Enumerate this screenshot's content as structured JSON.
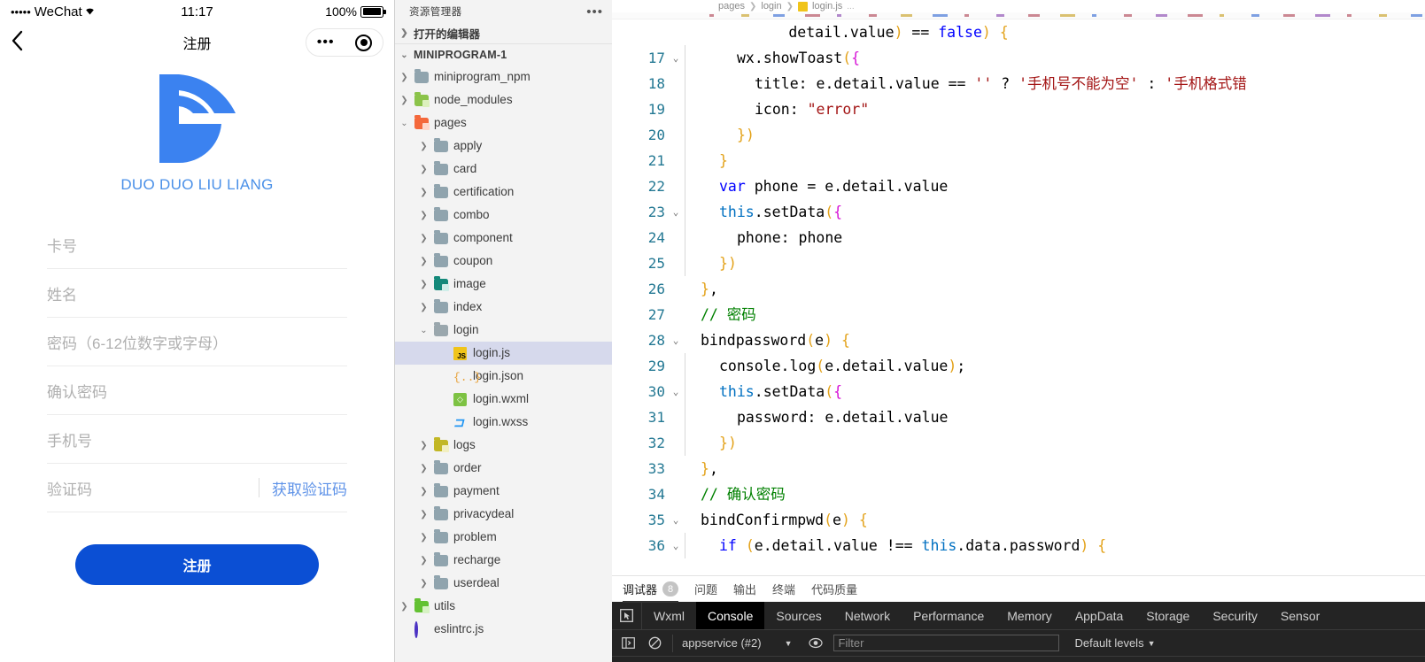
{
  "simulator": {
    "status_bar": {
      "signal_dots": "•••••",
      "carrier": "WeChat",
      "wifi_icon": "wifi-icon",
      "time": "11:17",
      "battery_percent": "100%",
      "battery_icon": "battery-full-icon"
    },
    "nav_bar": {
      "back_icon": "back-chevron-icon",
      "title": "注册",
      "capsule_menu_icon": "more-dots-icon",
      "capsule_close_icon": "target-circle-icon"
    },
    "brand": {
      "logo_icon": "duoduoliuliang-logo-icon",
      "logo_color": "#3b82f0",
      "name": "DUO DUO LIU LIANG"
    },
    "form": {
      "fields": [
        {
          "name": "card-number",
          "placeholder": "卡号"
        },
        {
          "name": "full-name",
          "placeholder": "姓名"
        },
        {
          "name": "password",
          "placeholder": "密码（6-12位数字或字母）"
        },
        {
          "name": "confirm-password",
          "placeholder": "确认密码"
        },
        {
          "name": "phone",
          "placeholder": "手机号"
        },
        {
          "name": "verify-code",
          "placeholder": "验证码"
        }
      ],
      "get_code_label": "获取验证码",
      "get_code_color": "#5f93e8",
      "submit_label": "注册",
      "submit_color": "#0b4fd4"
    }
  },
  "explorer": {
    "header_title": "资源管理器",
    "header_more_icon": "ellipsis-icon",
    "open_editors_label": "打开的编辑器",
    "root_label": "MINIPROGRAM-1",
    "tree": [
      {
        "label": "miniprogram_npm",
        "type": "folder",
        "depth": 1,
        "expanded": false,
        "icon": "folder-gray-icon"
      },
      {
        "label": "node_modules",
        "type": "folder",
        "depth": 1,
        "expanded": false,
        "icon": "folder-node-icon"
      },
      {
        "label": "pages",
        "type": "folder",
        "depth": 1,
        "expanded": true,
        "icon": "folder-pages-icon"
      },
      {
        "label": "apply",
        "type": "folder",
        "depth": 2,
        "expanded": false,
        "icon": "folder-gray-icon"
      },
      {
        "label": "card",
        "type": "folder",
        "depth": 2,
        "expanded": false,
        "icon": "folder-gray-icon"
      },
      {
        "label": "certification",
        "type": "folder",
        "depth": 2,
        "expanded": false,
        "icon": "folder-gray-icon"
      },
      {
        "label": "combo",
        "type": "folder",
        "depth": 2,
        "expanded": false,
        "icon": "folder-gray-icon"
      },
      {
        "label": "component",
        "type": "folder",
        "depth": 2,
        "expanded": false,
        "icon": "folder-gray-icon"
      },
      {
        "label": "coupon",
        "type": "folder",
        "depth": 2,
        "expanded": false,
        "icon": "folder-gray-icon"
      },
      {
        "label": "image",
        "type": "folder",
        "depth": 2,
        "expanded": false,
        "icon": "folder-image-icon"
      },
      {
        "label": "index",
        "type": "folder",
        "depth": 2,
        "expanded": false,
        "icon": "folder-gray-icon"
      },
      {
        "label": "login",
        "type": "folder",
        "depth": 2,
        "expanded": true,
        "icon": "folder-open-icon"
      },
      {
        "label": "login.js",
        "type": "file",
        "depth": 3,
        "icon": "js-file-icon",
        "selected": true
      },
      {
        "label": "login.json",
        "type": "file",
        "depth": 3,
        "icon": "json-file-icon",
        "selected": false
      },
      {
        "label": "login.wxml",
        "type": "file",
        "depth": 3,
        "icon": "wxml-file-icon",
        "selected": false
      },
      {
        "label": "login.wxss",
        "type": "file",
        "depth": 3,
        "icon": "wxss-file-icon",
        "selected": false
      },
      {
        "label": "logs",
        "type": "folder",
        "depth": 2,
        "expanded": false,
        "icon": "folder-logs-icon"
      },
      {
        "label": "order",
        "type": "folder",
        "depth": 2,
        "expanded": false,
        "icon": "folder-gray-icon"
      },
      {
        "label": "payment",
        "type": "folder",
        "depth": 2,
        "expanded": false,
        "icon": "folder-gray-icon"
      },
      {
        "label": "privacydeal",
        "type": "folder",
        "depth": 2,
        "expanded": false,
        "icon": "folder-gray-icon"
      },
      {
        "label": "problem",
        "type": "folder",
        "depth": 2,
        "expanded": false,
        "icon": "folder-gray-icon"
      },
      {
        "label": "recharge",
        "type": "folder",
        "depth": 2,
        "expanded": false,
        "icon": "folder-gray-icon"
      },
      {
        "label": "userdeal",
        "type": "folder",
        "depth": 2,
        "expanded": false,
        "icon": "folder-gray-icon"
      },
      {
        "label": "utils",
        "type": "folder",
        "depth": 1,
        "expanded": false,
        "icon": "folder-utils-icon"
      },
      {
        "label": "eslintrc.js",
        "type": "file",
        "depth": 1,
        "icon": "eslint-file-icon",
        "selected": false
      }
    ]
  },
  "editor": {
    "breadcrumb": {
      "pages": "pages",
      "login": "login",
      "file": "login.js",
      "more": "..."
    },
    "first_line_partial": "detail.value) == false) {",
    "lines": [
      {
        "num": "17",
        "fold": true,
        "indent": 2,
        "text": "wx.showToast({"
      },
      {
        "num": "18",
        "fold": false,
        "indent": 3,
        "text": "title: e.detail.value == '' ? '手机号不能为空' : '手机格式错"
      },
      {
        "num": "19",
        "fold": false,
        "indent": 3,
        "text": "icon: \"error\""
      },
      {
        "num": "20",
        "fold": false,
        "indent": 2,
        "text": "})"
      },
      {
        "num": "21",
        "fold": false,
        "indent": 1,
        "text": "}"
      },
      {
        "num": "22",
        "fold": false,
        "indent": 1,
        "text": "var phone = e.detail.value"
      },
      {
        "num": "23",
        "fold": true,
        "indent": 1,
        "text": "this.setData({"
      },
      {
        "num": "24",
        "fold": false,
        "indent": 2,
        "text": "phone: phone"
      },
      {
        "num": "25",
        "fold": false,
        "indent": 1,
        "text": "})"
      },
      {
        "num": "26",
        "fold": false,
        "indent": 0,
        "text": "},"
      },
      {
        "num": "27",
        "fold": false,
        "indent": 0,
        "text": "// 密码"
      },
      {
        "num": "28",
        "fold": true,
        "indent": 0,
        "text": "bindpassword(e) {"
      },
      {
        "num": "29",
        "fold": false,
        "indent": 1,
        "text": "console.log(e.detail.value);"
      },
      {
        "num": "30",
        "fold": true,
        "indent": 1,
        "text": "this.setData({"
      },
      {
        "num": "31",
        "fold": false,
        "indent": 2,
        "text": "password: e.detail.value"
      },
      {
        "num": "32",
        "fold": false,
        "indent": 1,
        "text": "})"
      },
      {
        "num": "33",
        "fold": false,
        "indent": 0,
        "text": "},"
      },
      {
        "num": "34",
        "fold": false,
        "indent": 0,
        "text": "// 确认密码"
      },
      {
        "num": "35",
        "fold": true,
        "indent": 0,
        "text": "bindConfirmpwd(e) {"
      },
      {
        "num": "36",
        "fold": true,
        "indent": 1,
        "text": "if (e.detail.value !== this.data.password) {"
      }
    ]
  },
  "panel": {
    "tabs": [
      {
        "label": "调试器",
        "badge": "8",
        "active": true
      },
      {
        "label": "问题",
        "badge": "",
        "active": false
      },
      {
        "label": "输出",
        "badge": "",
        "active": false
      },
      {
        "label": "终端",
        "badge": "",
        "active": false
      },
      {
        "label": "代码质量",
        "badge": "",
        "active": false
      }
    ]
  },
  "devtools": {
    "inspect_icon": "inspect-element-icon",
    "tabs": [
      {
        "label": "Wxml",
        "active": false
      },
      {
        "label": "Console",
        "active": true
      },
      {
        "label": "Sources",
        "active": false
      },
      {
        "label": "Network",
        "active": false
      },
      {
        "label": "Performance",
        "active": false
      },
      {
        "label": "Memory",
        "active": false
      },
      {
        "label": "AppData",
        "active": false
      },
      {
        "label": "Storage",
        "active": false
      },
      {
        "label": "Security",
        "active": false
      },
      {
        "label": "Sensor",
        "active": false
      }
    ],
    "toolbar": {
      "sidebar_icon": "console-sidebar-icon",
      "clear_icon": "clear-console-icon",
      "context_value": "appservice (#2)",
      "context_caret": "▼",
      "eye_icon": "live-expression-icon",
      "filter_placeholder": "Filter",
      "levels_label": "Default levels",
      "levels_caret": "▼"
    }
  }
}
